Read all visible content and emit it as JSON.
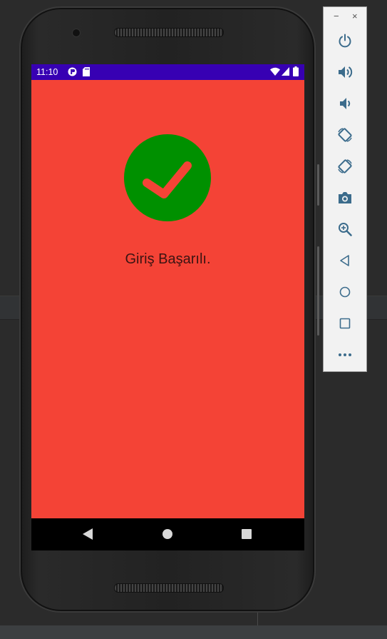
{
  "status_bar": {
    "time": "11:10",
    "icons": [
      "media-icon",
      "sd-card-icon",
      "wifi-icon",
      "signal-icon",
      "battery-icon"
    ],
    "background": "#3700b3"
  },
  "app": {
    "background": "#f44336",
    "success_icon": "check-circle-icon",
    "success_color": "#009000",
    "message": "Giriş Başarılı."
  },
  "nav_bar": {
    "buttons": [
      "back-icon",
      "home-icon",
      "recents-icon"
    ]
  },
  "emulator_toolbar": {
    "window_controls": [
      "−",
      "×"
    ],
    "buttons": [
      "power-icon",
      "volume-up-icon",
      "volume-down-icon",
      "rotate-left-icon",
      "rotate-right-icon",
      "camera-icon",
      "zoom-icon",
      "back-icon",
      "home-icon",
      "overview-icon",
      "more-icon"
    ],
    "accent": "#3c6c8c"
  }
}
